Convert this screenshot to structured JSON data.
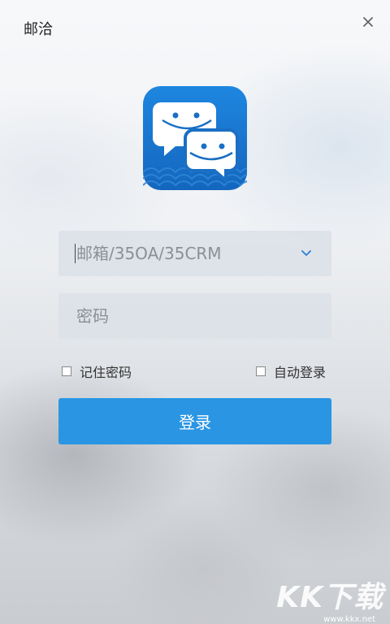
{
  "app": {
    "title": "邮洽"
  },
  "window": {
    "close_icon": "close-icon"
  },
  "logo": {
    "icon": "chat-bubbles-logo-icon",
    "bg_color": "#1a72c9"
  },
  "login_form": {
    "account": {
      "placeholder": "邮箱/35OA/35CRM",
      "value": ""
    },
    "password": {
      "placeholder": "密码",
      "value": ""
    },
    "remember_password": {
      "label": "记住密码",
      "checked": false
    },
    "auto_login": {
      "label": "自动登录",
      "checked": false
    },
    "login_button": {
      "label": "登录"
    }
  },
  "watermark": {
    "text": "KK下载",
    "url": "www.kkx.net"
  },
  "colors": {
    "accent": "#2a95e3",
    "field_bg": "#dce0e8"
  }
}
